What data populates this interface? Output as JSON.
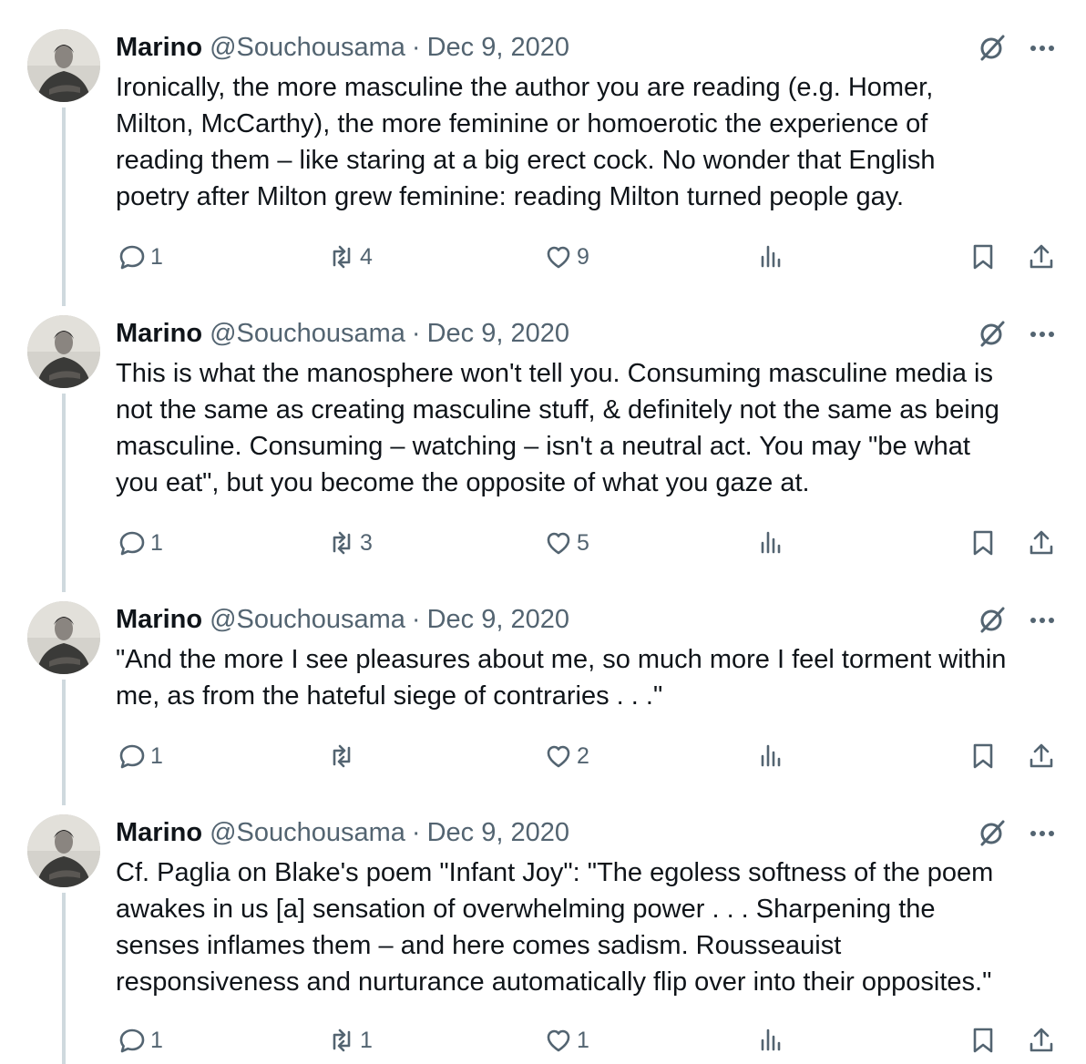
{
  "tweets": [
    {
      "name": "Marino",
      "handle": "@Souchousama",
      "separator": "·",
      "date": "Dec 9, 2020",
      "text": "Ironically, the more masculine the author you are reading (e.g. Homer,\nMilton, McCarthy), the more feminine or homoerotic the experience of\nreading them – like staring at a big erect cock. No wonder that English\npoetry after Milton grew feminine: reading Milton turned people gay.",
      "replies": "1",
      "retweets": "4",
      "likes": "9",
      "views": ""
    },
    {
      "name": "Marino",
      "handle": "@Souchousama",
      "separator": "·",
      "date": "Dec 9, 2020",
      "text": "This is what the manosphere won't tell you. Consuming masculine media is\nnot the same as creating masculine stuff, & definitely not the same as being\nmasculine. Consuming – watching – isn't a neutral act. You may \"be what\nyou eat\", but you become the opposite of what you gaze at.",
      "replies": "1",
      "retweets": "3",
      "likes": "5",
      "views": ""
    },
    {
      "name": "Marino",
      "handle": "@Souchousama",
      "separator": "·",
      "date": "Dec 9, 2020",
      "text": "\"And the more I see pleasures about me, so much more I feel torment within\nme, as from the hateful siege of contraries . . .\"",
      "replies": "1",
      "retweets": "",
      "likes": "2",
      "views": ""
    },
    {
      "name": "Marino",
      "handle": "@Souchousama",
      "separator": "·",
      "date": "Dec 9, 2020",
      "text": "Cf. Paglia on Blake's poem \"Infant Joy\": \"The egoless softness of the poem\nawakes in us [a] sensation of overwhelming power . . . Sharpening the\nsenses inflames them – and here comes sadism. Rousseauist\nresponsiveness and nurturance automatically flip over into their opposites.\"",
      "replies": "1",
      "retweets": "1",
      "likes": "1",
      "views": ""
    }
  ],
  "icons": {
    "reply": "reply-icon",
    "retweet": "retweet-icon",
    "like": "heart-icon",
    "views": "views-icon",
    "bookmark": "bookmark-icon",
    "share": "share-icon",
    "grok": "grok-icon",
    "more": "more-icon"
  },
  "colors": {
    "text": "#0f1419",
    "secondary": "#536471",
    "thread_line": "#cfd9de",
    "background": "#ffffff"
  }
}
